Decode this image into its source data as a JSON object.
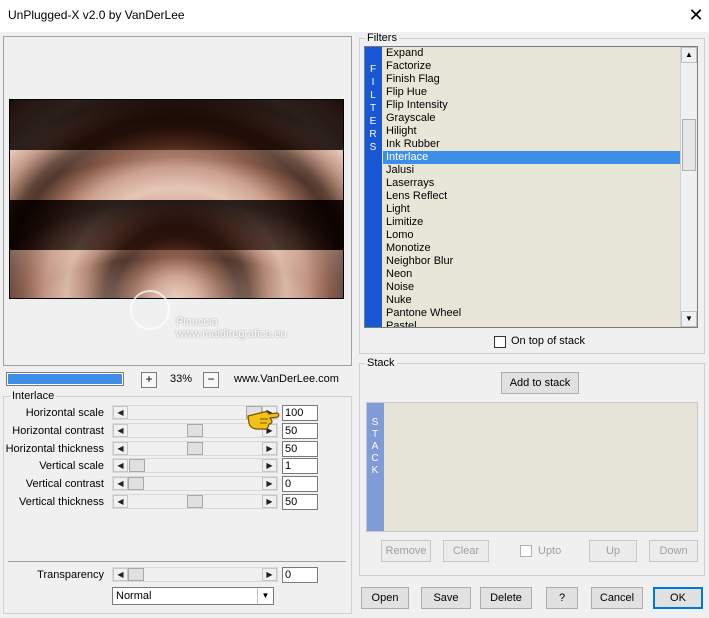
{
  "window": {
    "title": "UnPlugged-X v2.0 by VanDerLee",
    "close_glyph": "✕"
  },
  "preview": {
    "watermark_line1": "Pinuccia",
    "watermark_line2": "www.maidiregrafica.eu"
  },
  "zoom": {
    "progress_percent": 100,
    "plus": "+",
    "minus": "−",
    "value": "33%",
    "site": "www.VanDerLee.com"
  },
  "parameters": {
    "group_label": "Interlace",
    "rows": [
      {
        "label": "Horizontal scale",
        "value": "100",
        "position": 1.0
      },
      {
        "label": "Horizontal contrast",
        "value": "50",
        "position": 0.5
      },
      {
        "label": "Horizontal thickness",
        "value": "50",
        "position": 0.5
      },
      {
        "label": "Vertical scale",
        "value": "1",
        "position": 0.01
      },
      {
        "label": "Vertical contrast",
        "value": "0",
        "position": 0.0
      },
      {
        "label": "Vertical thickness",
        "value": "50",
        "position": 0.5
      }
    ],
    "transparency": {
      "label": "Transparency",
      "value": "0",
      "position": 0.0
    },
    "blend_mode": "Normal"
  },
  "filters": {
    "group_label": "Filters",
    "band_letters": [
      "F",
      "I",
      "L",
      "T",
      "E",
      "R",
      "S"
    ],
    "items": [
      "Expand",
      "Factorize",
      "Finish Flag",
      "Flip Hue",
      "Flip Intensity",
      "Grayscale",
      "Hilight",
      "Ink Rubber",
      "Interlace",
      "Jalusi",
      "Laserrays",
      "Lens Reflect",
      "Light",
      "Limitize",
      "Lomo",
      "Monotize",
      "Neighbor Blur",
      "Neon",
      "Noise",
      "Nuke",
      "Pantone Wheel",
      "Pastel"
    ],
    "selected_index": 8,
    "on_top_label": "On top of stack"
  },
  "stack": {
    "group_label": "Stack",
    "add_button": "Add to stack",
    "band_letters": [
      "S",
      "T",
      "A",
      "C",
      "K"
    ],
    "remove": "Remove",
    "clear": "Clear",
    "upto": "Upto",
    "up": "Up",
    "down": "Down"
  },
  "footer": {
    "open": "Open",
    "save": "Save",
    "delete": "Delete",
    "help": "?",
    "cancel": "Cancel",
    "ok": "OK"
  },
  "colors": {
    "accent": "#3c8ee8",
    "filter_band": "#1757d3",
    "stack_band": "#7f9bd8"
  }
}
